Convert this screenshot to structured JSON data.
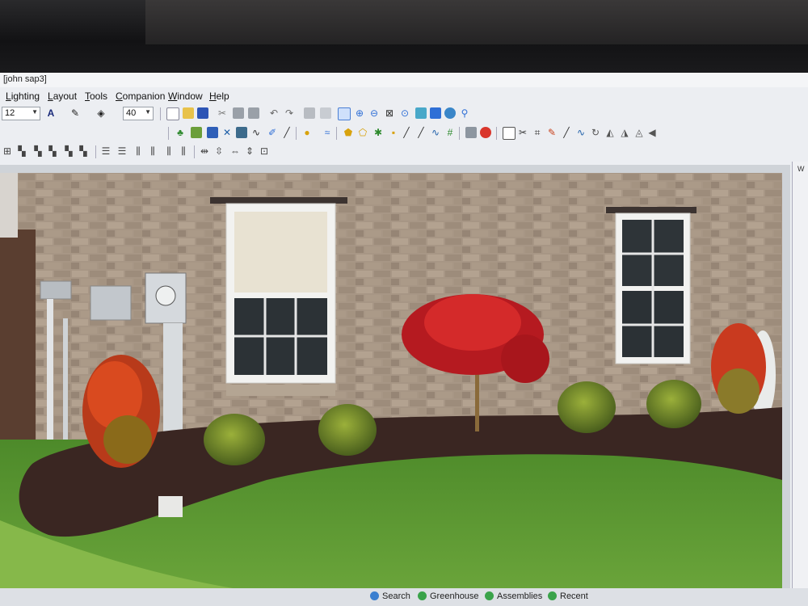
{
  "window": {
    "title": "[john sap3]"
  },
  "menu": [
    "Lighting",
    "Layout",
    "Tools",
    "Companion",
    "Window",
    "Help"
  ],
  "toolbar": {
    "font_size": "12",
    "zoom": "40",
    "icons": [
      "font-color-icon",
      "pen-icon",
      "fill-bucket-icon",
      "new-file-icon",
      "open-folder-icon",
      "save-icon",
      "cut-icon",
      "copy-icon",
      "paste-icon",
      "undo-icon",
      "redo-icon",
      "print-icon",
      "print-preview-icon",
      "pointer-icon",
      "zoom-in-icon",
      "zoom-out-icon",
      "zoom-fit-icon",
      "magnify-icon",
      "image-icon",
      "monitor-icon",
      "globe-icon",
      "search-icon"
    ]
  },
  "status_tabs": [
    {
      "label": "Search",
      "color": "#3a7fd0"
    },
    {
      "label": "Greenhouse",
      "color": "#3aa34a"
    },
    {
      "label": "Assemblies",
      "color": "#3aa34a"
    },
    {
      "label": "Recent",
      "color": "#3aa34a"
    }
  ],
  "colors": {
    "accent": "#2f6fd6",
    "maple": "#c0191f",
    "lawn": "#4f8f2a",
    "mulch": "#3a2622",
    "brick": "#a79685"
  }
}
